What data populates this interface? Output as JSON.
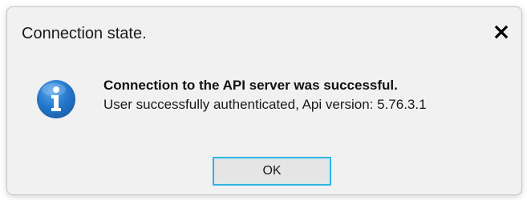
{
  "dialog": {
    "title": "Connection state.",
    "message_heading": "Connection to the API server was successful.",
    "message_detail": "User successfully authenticated, Api version: 5.76.3.1",
    "ok_label": "OK",
    "icon": "info-icon",
    "close_icon": "close-icon"
  },
  "colors": {
    "dialog_bg": "#f1f1f1",
    "info_icon": "#1e73c9",
    "button_focus_border": "#2fb6e0"
  }
}
